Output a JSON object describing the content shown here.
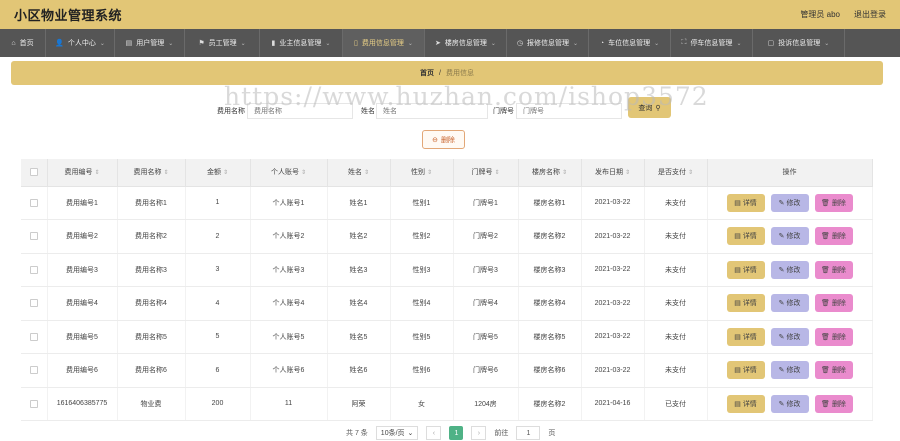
{
  "app": {
    "title": "小区物业管理系统",
    "user": "管理员 abo",
    "logout": "退出登录"
  },
  "nav": [
    {
      "icon": "⌂",
      "label": "首页",
      "chevron": false,
      "active": false
    },
    {
      "icon": "👤",
      "label": "个人中心",
      "chevron": true,
      "active": false
    },
    {
      "icon": "▤",
      "label": "用户管理",
      "chevron": true,
      "active": false
    },
    {
      "icon": "⚑",
      "label": "员工管理",
      "chevron": true,
      "active": false
    },
    {
      "icon": "▮",
      "label": "业主信息管理",
      "chevron": true,
      "active": false
    },
    {
      "icon": "▯",
      "label": "费用信息管理",
      "chevron": true,
      "active": true
    },
    {
      "icon": "➤",
      "label": "楼房信息管理",
      "chevron": true,
      "active": false
    },
    {
      "icon": "◷",
      "label": "报修信息管理",
      "chevron": true,
      "active": false
    },
    {
      "icon": "◔",
      "label": "车位信息管理",
      "chevron": true,
      "active": false
    },
    {
      "icon": "⛶",
      "label": "停车信息管理",
      "chevron": true,
      "active": false
    },
    {
      "icon": "▢",
      "label": "投诉信息管理",
      "chevron": true,
      "active": false
    }
  ],
  "breadcrumb": {
    "home": "首页",
    "sep": "/",
    "current": "费用信息"
  },
  "watermark": "https://www.huzhan.com/ishop3572",
  "search": {
    "fields": [
      {
        "label": "费用名称",
        "placeholder": "费用名称"
      },
      {
        "label": "姓名",
        "placeholder": "姓名"
      },
      {
        "label": "门牌号",
        "placeholder": "门牌号"
      }
    ],
    "button": "查询",
    "button_icon": "⚲"
  },
  "delete_button": {
    "label": "删除",
    "icon": "⊖"
  },
  "table": {
    "headers": [
      "费用编号",
      "费用名称",
      "金额",
      "个人账号",
      "姓名",
      "性别",
      "门牌号",
      "楼房名称",
      "发布日期",
      "是否支付",
      "操作"
    ],
    "rows": [
      [
        "费用编号1",
        "费用名称1",
        "1",
        "个人账号1",
        "姓名1",
        "性别1",
        "门牌号1",
        "楼房名称1",
        "2021-03-22",
        "未支付"
      ],
      [
        "费用编号2",
        "费用名称2",
        "2",
        "个人账号2",
        "姓名2",
        "性别2",
        "门牌号2",
        "楼房名称2",
        "2021-03-22",
        "未支付"
      ],
      [
        "费用编号3",
        "费用名称3",
        "3",
        "个人账号3",
        "姓名3",
        "性别3",
        "门牌号3",
        "楼房名称3",
        "2021-03-22",
        "未支付"
      ],
      [
        "费用编号4",
        "费用名称4",
        "4",
        "个人账号4",
        "姓名4",
        "性别4",
        "门牌号4",
        "楼房名称4",
        "2021-03-22",
        "未支付"
      ],
      [
        "费用编号5",
        "费用名称5",
        "5",
        "个人账号5",
        "姓名5",
        "性别5",
        "门牌号5",
        "楼房名称5",
        "2021-03-22",
        "未支付"
      ],
      [
        "费用编号6",
        "费用名称6",
        "6",
        "个人账号6",
        "姓名6",
        "性别6",
        "门牌号6",
        "楼房名称6",
        "2021-03-22",
        "未支付"
      ],
      [
        "1616406385775",
        "物业费",
        "200",
        "11",
        "阿荣",
        "女",
        "1204房",
        "楼房名称2",
        "2021-04-16",
        "已支付"
      ]
    ],
    "actions": {
      "detail": "详情",
      "edit": "修改",
      "delete": "删除"
    }
  },
  "pager": {
    "total": "共 7 条",
    "page_size": "10条/页",
    "prev": "‹",
    "current": "1",
    "next": "›",
    "goto_label": "前往",
    "goto_value": "1",
    "page_unit": "页"
  }
}
